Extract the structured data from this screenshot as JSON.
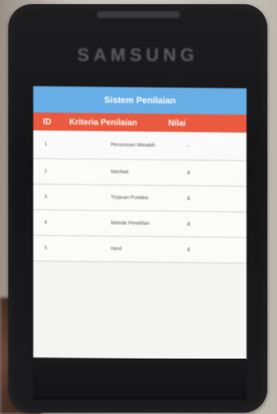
{
  "phone": {
    "brand": "SAMSUNG"
  },
  "app": {
    "title": "Sistem Penilaian",
    "columns": {
      "no": "ID",
      "kriteria": "Kriteria Penilaian",
      "nilai": "Nilai"
    },
    "rows": [
      {
        "no": "1",
        "kriteria": "Perumusan Masalah",
        "nilai": "-"
      },
      {
        "no": "2",
        "kriteria": "Manfaat",
        "nilai": "4"
      },
      {
        "no": "3",
        "kriteria": "Tinjauan Pustaka",
        "nilai": "4"
      },
      {
        "no": "4",
        "kriteria": "Metode Penelitian",
        "nilai": "4"
      },
      {
        "no": "5",
        "kriteria": "Hasil",
        "nilai": "4"
      }
    ]
  }
}
